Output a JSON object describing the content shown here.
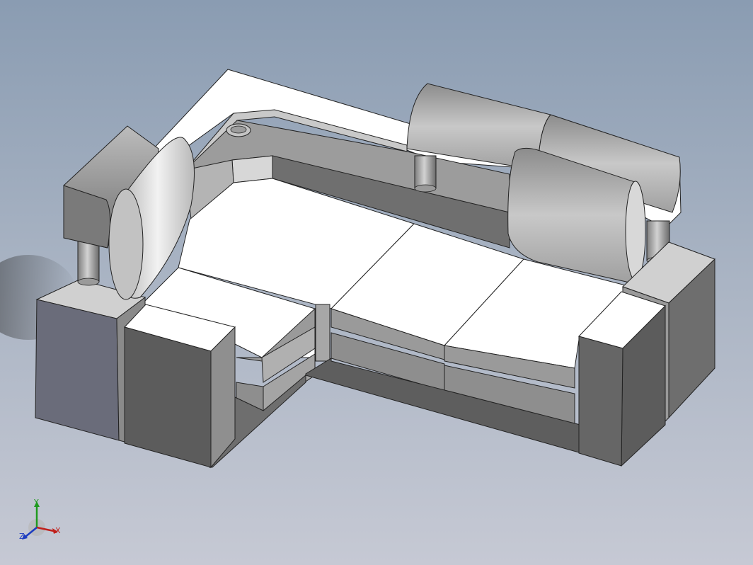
{
  "view": {
    "title": "",
    "background_top": "#8a9cb2",
    "background_bottom": "#c6c9d4",
    "model": "sectional-sofa-isometric"
  },
  "triad": {
    "x_label": "X",
    "y_label": "Y",
    "z_label": "Z",
    "x_color": "#c0201c",
    "y_color": "#1f9a1f",
    "z_color": "#1c3cc0"
  }
}
